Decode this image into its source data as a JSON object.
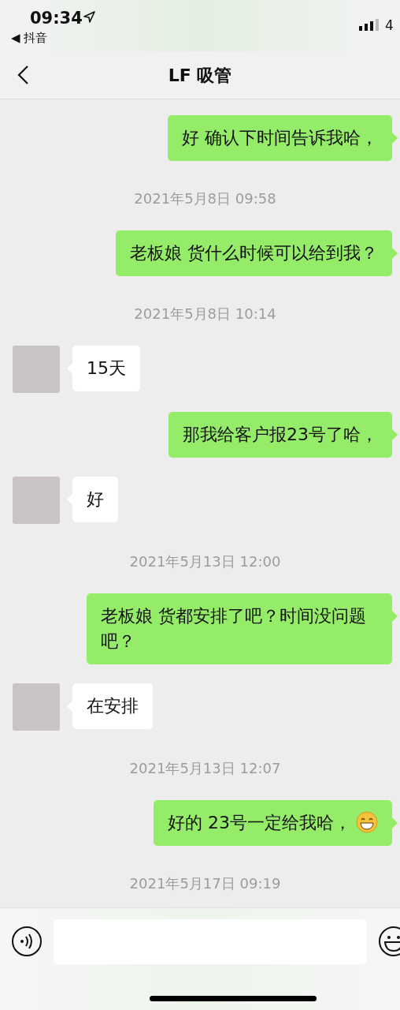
{
  "status_bar": {
    "time": "09:34",
    "back_app": "◀ 抖音",
    "network": "4"
  },
  "nav": {
    "title": "LF 吸管"
  },
  "messages": [
    {
      "kind": "sent",
      "text": "好 确认下时间告诉我哈，"
    },
    {
      "kind": "time",
      "text": "2021年5月8日 09:58"
    },
    {
      "kind": "sent",
      "text": "老板娘 货什么时候可以给到我？"
    },
    {
      "kind": "time",
      "text": "2021年5月8日 10:14"
    },
    {
      "kind": "received",
      "text": "15天"
    },
    {
      "kind": "sent",
      "text": "那我给客户报23号了哈，"
    },
    {
      "kind": "received",
      "text": "好"
    },
    {
      "kind": "time",
      "text": "2021年5月13日 12:00"
    },
    {
      "kind": "sent",
      "text": "老板娘 货都安排了吧？时间没问题吧？"
    },
    {
      "kind": "received",
      "text": "在安排"
    },
    {
      "kind": "time",
      "text": "2021年5月13日 12:07"
    },
    {
      "kind": "sent",
      "text": "好的 23号一定给我哈，",
      "emoji": true
    },
    {
      "kind": "time",
      "text": "2021年5月17日 09:19"
    }
  ]
}
